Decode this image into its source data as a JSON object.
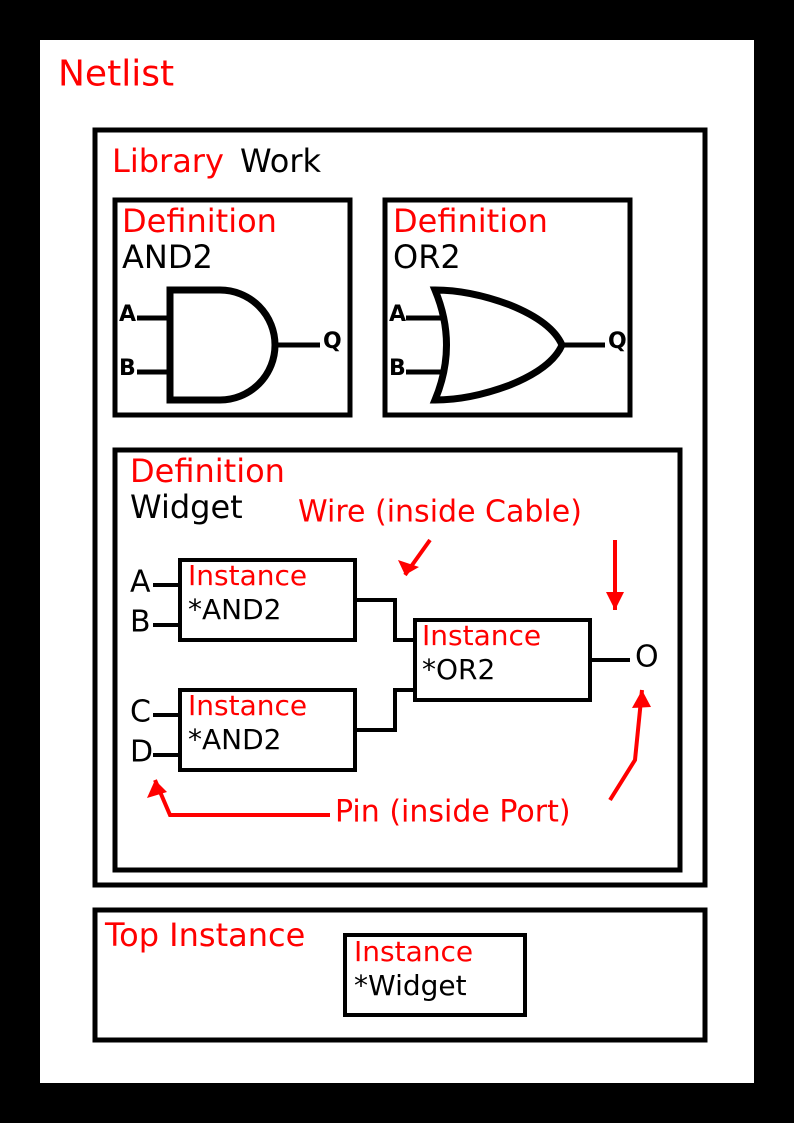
{
  "netlist_label": "Netlist",
  "library": {
    "label": "Library",
    "name": "Work",
    "defs": {
      "and2": {
        "label": "Definition",
        "name": "AND2",
        "inA": "A",
        "inB": "B",
        "out": "Q"
      },
      "or2": {
        "label": "Definition",
        "name": "OR2",
        "inA": "A",
        "inB": "B",
        "out": "Q"
      }
    },
    "widget_def": {
      "label": "Definition",
      "name": "Widget",
      "wire_label": "Wire (inside Cable)",
      "pin_label": "Pin (inside Port)",
      "portA": "A",
      "portB": "B",
      "portC": "C",
      "portD": "D",
      "portO": "O",
      "inst_label": "Instance",
      "inst_and2_ref": "*AND2",
      "inst_or2_ref": "*OR2"
    }
  },
  "top_instance": {
    "label": "Top Instance",
    "inst_label": "Instance",
    "ref": "*Widget"
  }
}
